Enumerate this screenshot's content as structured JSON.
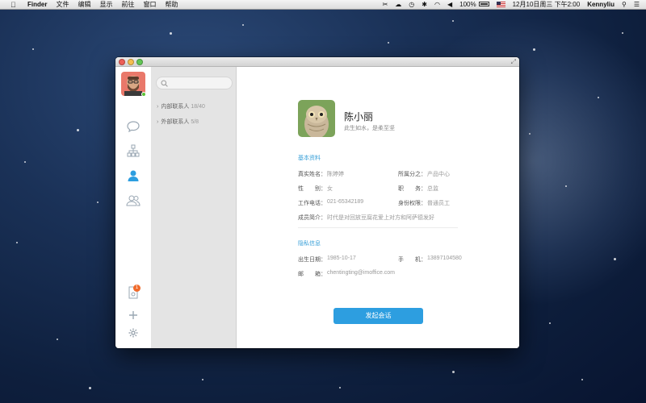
{
  "menubar": {
    "app_name": "Finder",
    "items": [
      "文件",
      "编辑",
      "显示",
      "前往",
      "窗口",
      "帮助"
    ],
    "battery": "100%",
    "datetime": "12月10日周三 下午2:00",
    "username": "Kennyliu"
  },
  "contacts": {
    "search_placeholder": "",
    "groups": [
      {
        "name": "内部联系人",
        "count": "18/40"
      },
      {
        "name": "外部联系人",
        "count": "5/8"
      }
    ]
  },
  "nav": {
    "badge_count": "1"
  },
  "profile": {
    "name": "陈小丽",
    "motto": "此生如水，是柔至坚"
  },
  "basic_info": {
    "title": "基本资料",
    "fields": {
      "real_name": {
        "label": "真实姓名：",
        "value": "陈婷婷"
      },
      "branch": {
        "label": "所属分之：",
        "value": "产品中心"
      },
      "gender": {
        "label": "性　　别：",
        "value": "女"
      },
      "position": {
        "label": "职　　务：",
        "value": "总监"
      },
      "phone": {
        "label": "工作电话：",
        "value": "021-65342189"
      },
      "permission": {
        "label": "身份权限：",
        "value": "普通员工"
      },
      "intro": {
        "label": "成员简介：",
        "value": "时代是对回放豆腐花爱上对方和阿萨德发好"
      }
    }
  },
  "private_info": {
    "title": "隐私信息",
    "fields": {
      "birthday": {
        "label": "出生日期：",
        "value": "1985-10-17"
      },
      "mobile": {
        "label": "手　　机：",
        "value": "13897104580"
      },
      "email": {
        "label": "邮　　箱：",
        "value": "chentingting@imoffice.com"
      }
    }
  },
  "actions": {
    "start_chat": "发起会话"
  },
  "colors": {
    "accent": "#2d9ee0",
    "section_title": "#3aa0d8",
    "badge": "#f06a2a",
    "online": "#5bc236"
  }
}
